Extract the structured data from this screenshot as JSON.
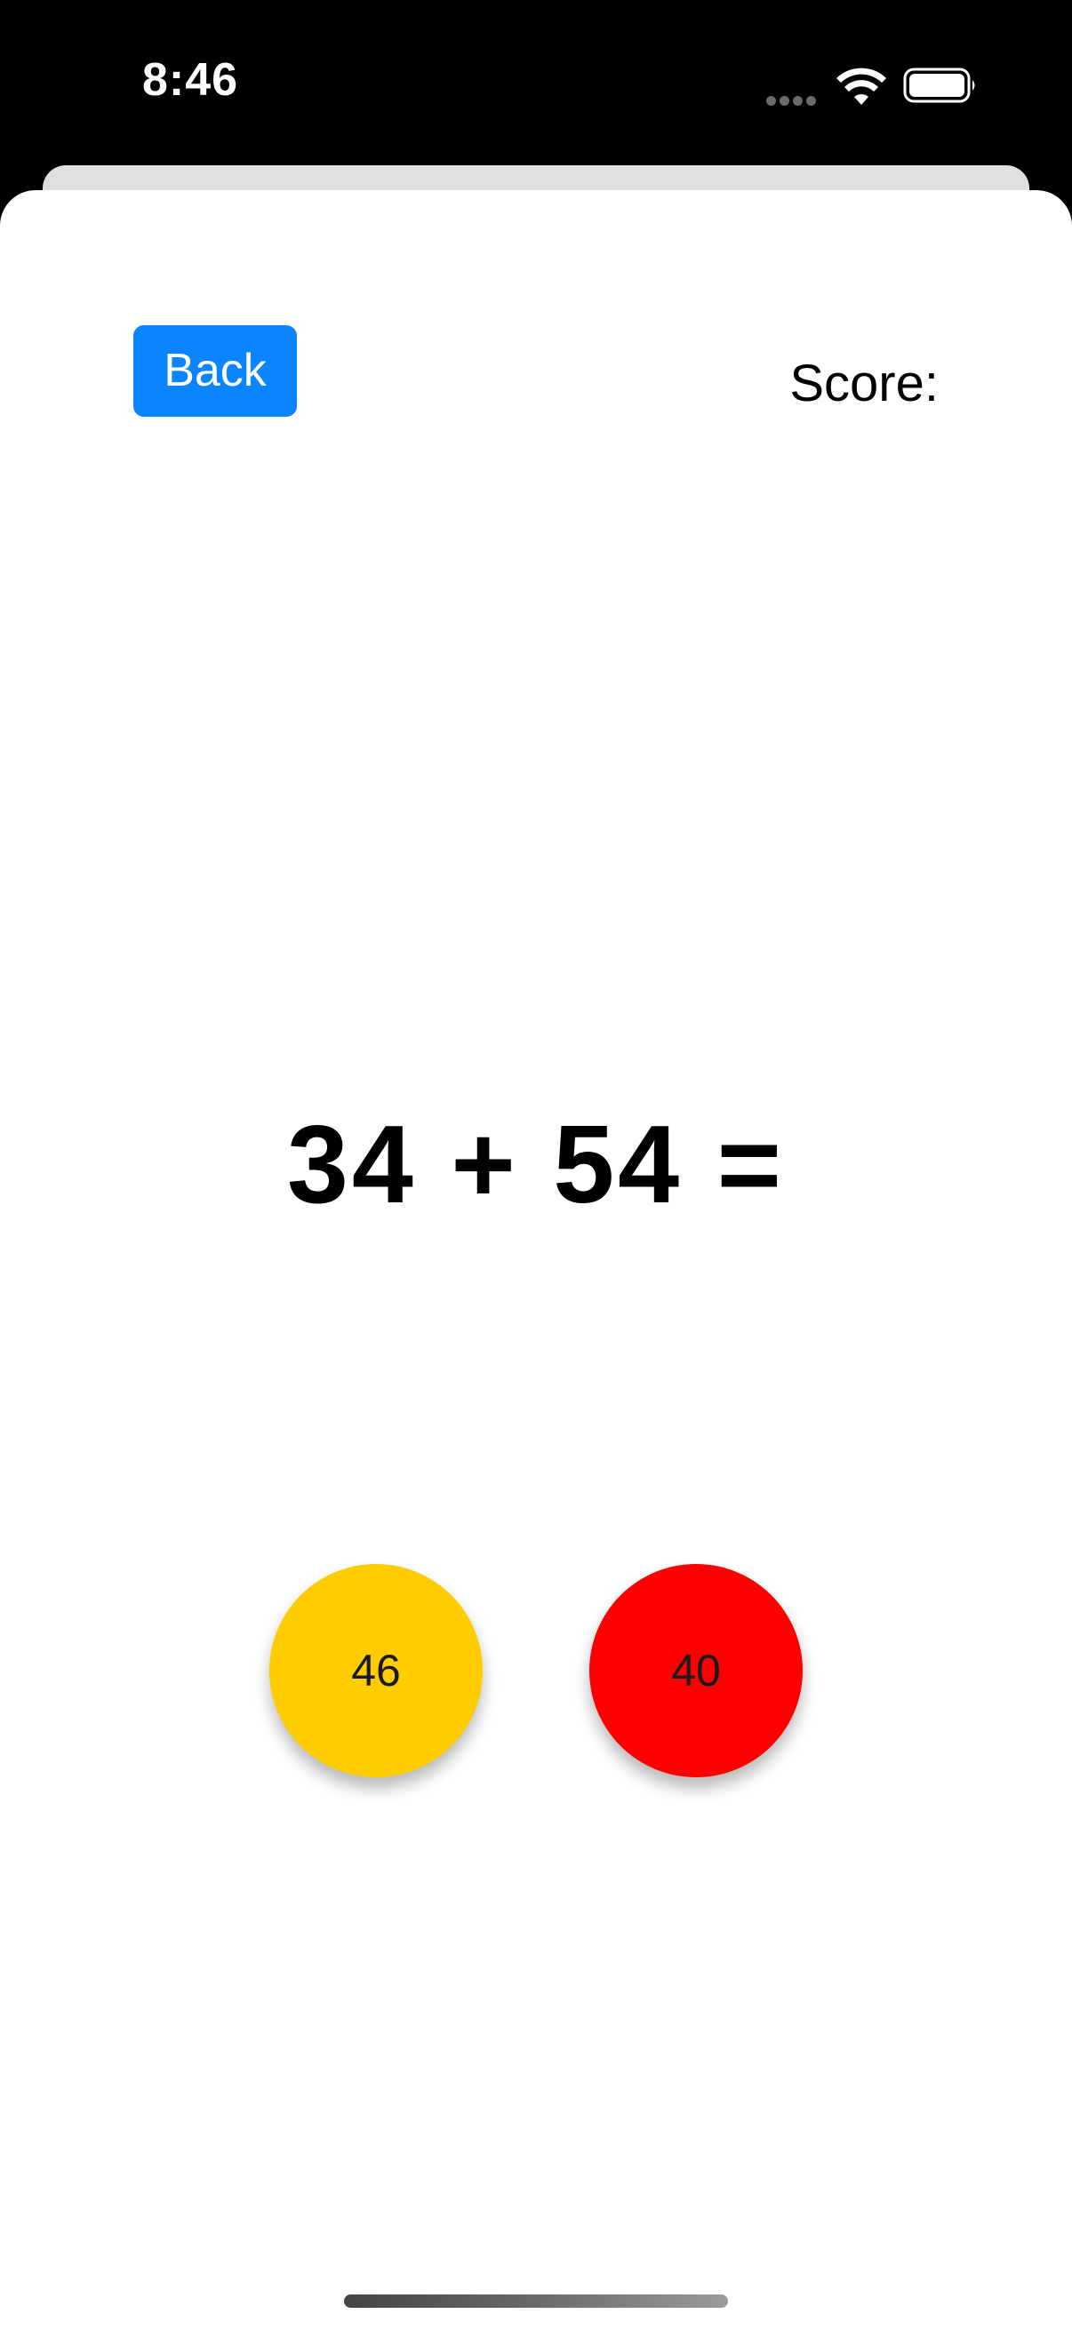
{
  "status_bar": {
    "time": "8:46",
    "icons": [
      "signal-dots-icon",
      "wifi-icon",
      "battery-icon"
    ]
  },
  "toolbar": {
    "back_label": "Back",
    "score_label": "Score:"
  },
  "question": {
    "equation": "34 + 54 ="
  },
  "answers": [
    {
      "label": "46",
      "color": "#ffcc00"
    },
    {
      "label": "40",
      "color": "#ff0000"
    }
  ],
  "colors": {
    "accent": "#0a84ff",
    "sheet_background": "#ffffff",
    "status_bar_background": "#000000"
  }
}
